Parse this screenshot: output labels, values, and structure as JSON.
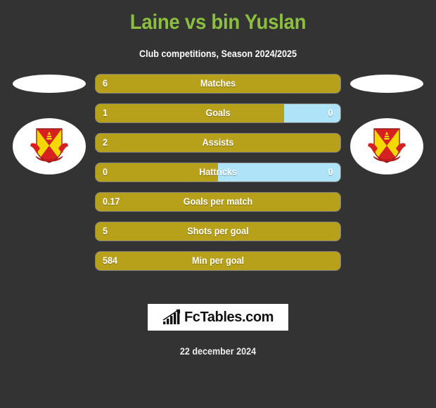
{
  "header": {
    "title": "Laine vs bin Yuslan",
    "subtitle": "Club competitions, Season 2024/2025"
  },
  "colors": {
    "background": "#333333",
    "title_green": "#8CBF3F",
    "bar_gold": "#B8A11A",
    "bar_blue": "#AEE3F8",
    "text_white": "#FFFFFF",
    "crest_red": "#D62121",
    "crest_yellow": "#F5D800"
  },
  "teams": {
    "left": {
      "crest_name": "selangor-fc-crest"
    },
    "right": {
      "crest_name": "selangor-fc-crest"
    }
  },
  "stats": [
    {
      "label": "Matches",
      "left": "6",
      "right": "",
      "left_pct": 100
    },
    {
      "label": "Goals",
      "left": "1",
      "right": "0",
      "left_pct": 77
    },
    {
      "label": "Assists",
      "left": "2",
      "right": "",
      "left_pct": 100
    },
    {
      "label": "Hattricks",
      "left": "0",
      "right": "0",
      "left_pct": 50
    },
    {
      "label": "Goals per match",
      "left": "0.17",
      "right": "",
      "left_pct": 100
    },
    {
      "label": "Shots per goal",
      "left": "5",
      "right": "",
      "left_pct": 100
    },
    {
      "label": "Min per goal",
      "left": "584",
      "right": "",
      "left_pct": 100
    }
  ],
  "footer": {
    "logo_text": "FcTables.com",
    "logo_icon": "bar-chart-arrow-icon",
    "date": "22 december 2024"
  }
}
